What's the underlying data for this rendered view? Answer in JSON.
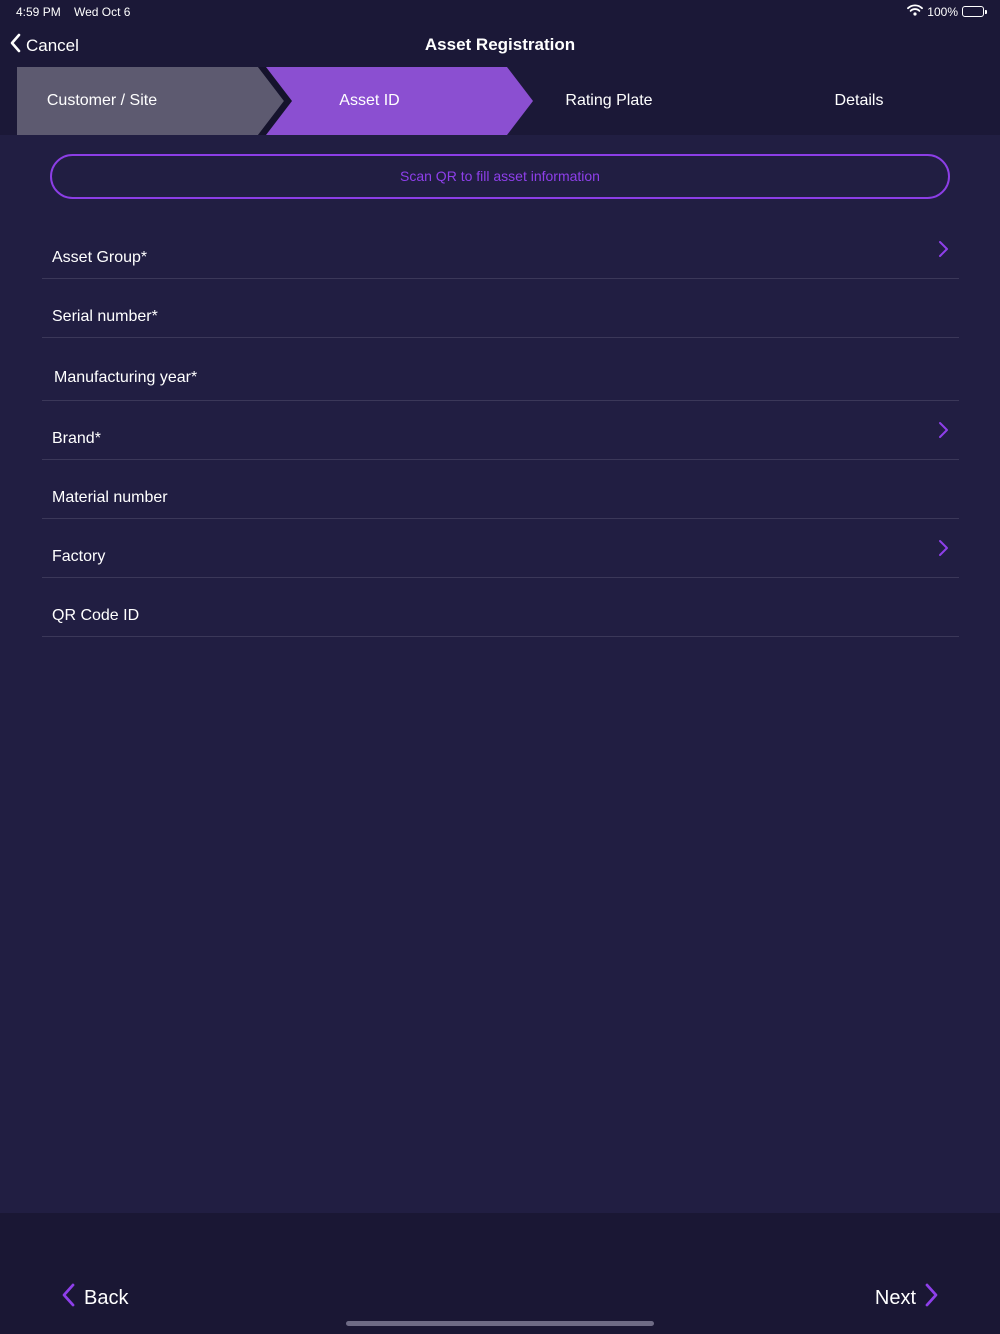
{
  "status_bar": {
    "time": "4:59 PM",
    "date": "Wed Oct 6",
    "battery_text": "100%",
    "battery_level": 1.0
  },
  "nav": {
    "cancel_label": "Cancel",
    "title": "Asset Registration"
  },
  "stepper": {
    "steps": [
      {
        "label": "Customer / Site",
        "state": "completed"
      },
      {
        "label": "Asset ID",
        "state": "active"
      },
      {
        "label": "Rating Plate",
        "state": "upcoming"
      },
      {
        "label": "Details",
        "state": "upcoming"
      }
    ]
  },
  "scan_button_label": "Scan QR to fill asset information",
  "form": {
    "fields": [
      {
        "label": "Asset Group*",
        "has_chevron": true
      },
      {
        "label": "Serial number*",
        "has_chevron": false
      },
      {
        "label": "Manufacturing year*",
        "has_chevron": false
      },
      {
        "label": "Brand*",
        "has_chevron": true
      },
      {
        "label": "Material number",
        "has_chevron": false
      },
      {
        "label": "Factory",
        "has_chevron": true
      },
      {
        "label": "QR Code ID",
        "has_chevron": false
      }
    ]
  },
  "footer": {
    "back_label": "Back",
    "next_label": "Next"
  },
  "colors": {
    "background": "#211e42",
    "header": "#1b1837",
    "accent": "#8e3fea",
    "step_active": "#8b4fd1",
    "step_completed": "#5d5a70"
  },
  "icons": {
    "cancel": "chevron-left-icon",
    "field_chevron": "chevron-right-icon",
    "back": "chevron-left-icon",
    "next": "chevron-right-icon",
    "wifi": "wifi-icon",
    "battery": "battery-icon"
  }
}
